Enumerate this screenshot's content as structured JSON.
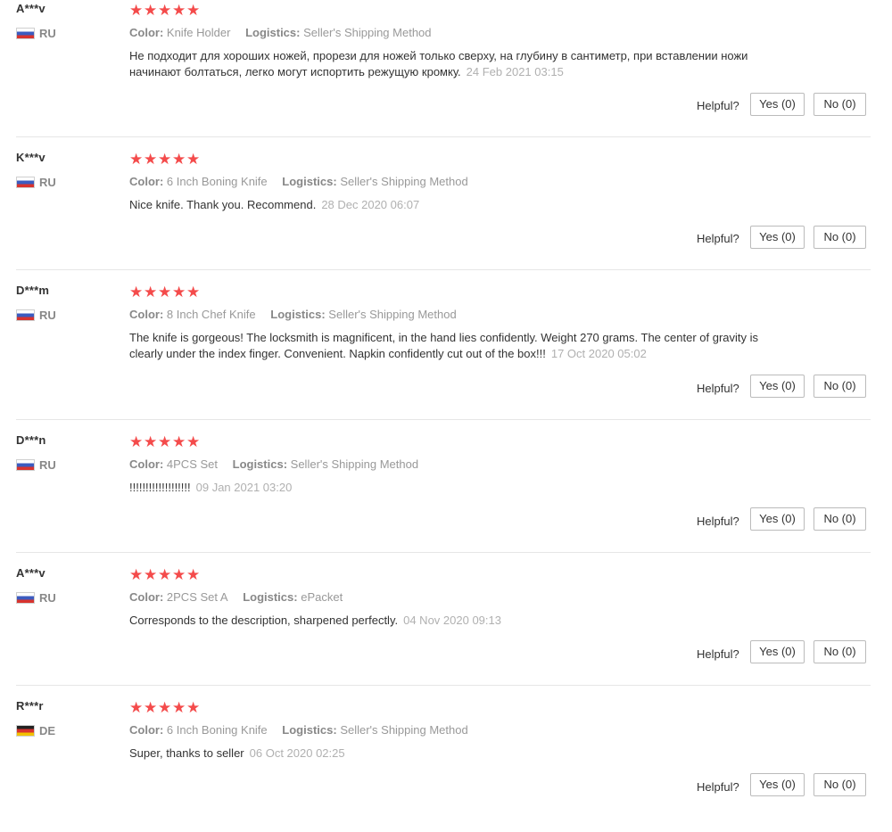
{
  "helpful_label": "Helpful?",
  "reviews": [
    {
      "user": "A***v",
      "country": "RU",
      "stars": 5,
      "color_label": "Color:",
      "color": "Knife Holder",
      "logistics_label": "Logistics:",
      "logistics": "Seller's Shipping Method",
      "text": "Не подходит для хороших ножей, прорези для ножей только сверху, на глубину в сантиметр, при вставлении ножи начинают болтаться, легко могут испортить режущую кромку.",
      "date": "24 Feb 2021 03:15",
      "yes": "Yes (0)",
      "no": "No (0)"
    },
    {
      "user": "K***v",
      "country": "RU",
      "stars": 5,
      "color_label": "Color:",
      "color": "6 Inch Boning Knife",
      "logistics_label": "Logistics:",
      "logistics": "Seller's Shipping Method",
      "text": "Nice knife. Thank you. Recommend.",
      "date": "28 Dec 2020 06:07",
      "yes": "Yes (0)",
      "no": "No (0)"
    },
    {
      "user": "D***m",
      "country": "RU",
      "stars": 5,
      "color_label": "Color:",
      "color": "8 Inch Chef Knife",
      "logistics_label": "Logistics:",
      "logistics": "Seller's Shipping Method",
      "text": "The knife is gorgeous! The locksmith is magnificent, in the hand lies confidently. Weight 270 grams. The center of gravity is clearly under the index finger. Convenient. Napkin confidently cut out of the box!!!",
      "date": "17 Oct 2020 05:02",
      "yes": "Yes (0)",
      "no": "No (0)"
    },
    {
      "user": "D***n",
      "country": "RU",
      "stars": 5,
      "color_label": "Color:",
      "color": "4PCS Set",
      "logistics_label": "Logistics:",
      "logistics": "Seller's Shipping Method",
      "text": "!!!!!!!!!!!!!!!!!!!",
      "date": "09 Jan 2021 03:20",
      "yes": "Yes (0)",
      "no": "No (0)"
    },
    {
      "user": "A***v",
      "country": "RU",
      "stars": 5,
      "color_label": "Color:",
      "color": "2PCS Set A",
      "logistics_label": "Logistics:",
      "logistics": "ePacket",
      "text": "Corresponds to the description, sharpened perfectly.",
      "date": "04 Nov 2020 09:13",
      "yes": "Yes (0)",
      "no": "No (0)"
    },
    {
      "user": "R***r",
      "country": "DE",
      "stars": 5,
      "color_label": "Color:",
      "color": "6 Inch Boning Knife",
      "logistics_label": "Logistics:",
      "logistics": "Seller's Shipping Method",
      "text": "Super, thanks to seller",
      "date": "06 Oct 2020 02:25",
      "yes": "Yes (0)",
      "no": "No (0)"
    }
  ],
  "colors": {
    "star": "#f44b4b",
    "separator": "#e6e6e6",
    "date": "#b0b0b0"
  },
  "icons": {
    "star": "star-icon",
    "flag_ru": "russia-flag-icon",
    "flag_de": "germany-flag-icon"
  }
}
